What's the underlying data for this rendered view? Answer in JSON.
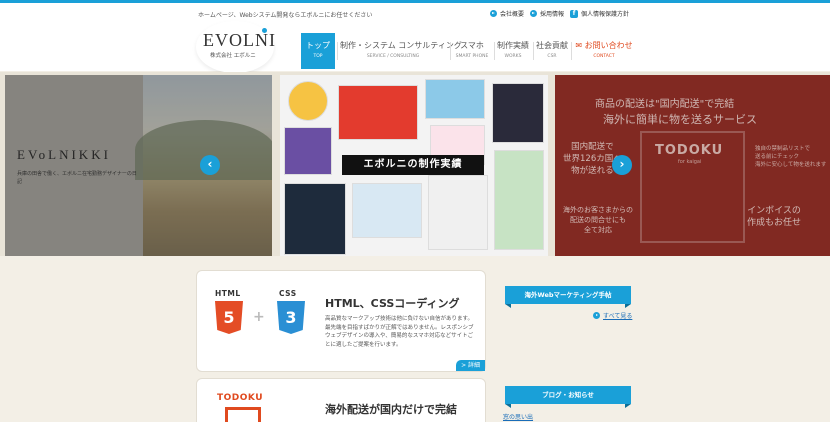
{
  "header": {
    "tagline": "ホームページ、Webシステム開発ならエボルニにお任せください",
    "util_links": [
      {
        "label": "会社概要",
        "icon": "arrow-circle-icon"
      },
      {
        "label": "採用情報",
        "icon": "arrow-circle-icon"
      },
      {
        "label": "個人情報保護方針",
        "icon": "facebook-icon"
      }
    ],
    "logo": "EVOLNI",
    "logo_sub": "株式会社 エボルニ",
    "nav": [
      {
        "ja": "トップ",
        "en": "TOP",
        "active": true
      },
      {
        "ja": "制作・システム コンサルティング",
        "en": "SERVICE / CONSULTING"
      },
      {
        "ja": "スマホ",
        "en": "SMART PHONE"
      },
      {
        "ja": "制作実績",
        "en": "WORKS"
      },
      {
        "ja": "社会貢献",
        "en": "CSR"
      },
      {
        "ja": "お問い合わせ",
        "en": "CONTACT",
        "icon": "mail-icon"
      }
    ]
  },
  "slider": {
    "left": {
      "title": "EVoLNIKKI",
      "sub": "兵庫の田舎で働く、エボルニ在宅勤務デザイナーの日記"
    },
    "center": {
      "label": "エボルニの制作実績"
    },
    "right": {
      "head1": "商品の配送は\"国内配送\"で完結",
      "head2": "海外に簡単に物を送るサービス",
      "left_text": [
        "国内配送で",
        "世界126カ国へ",
        "物が送れる"
      ],
      "left_text2": [
        "海外のお客さまからの",
        "配送の問合せにも",
        "全て対応"
      ],
      "logo": "TODOKU",
      "logo_sub": "for kaigai",
      "right_small": [
        "独自の禁制品リストで",
        "送る前にチェック",
        "海外に安心して物を送れます"
      ],
      "right_big": [
        "インボイスの",
        "作成もお任せ"
      ]
    },
    "prev_icon": "chevron-left-icon",
    "next_icon": "chevron-right-icon"
  },
  "cards": [
    {
      "title": "HTML、CSSコーディング",
      "text": "高品質なマークアップ技術は他に負けない自信があります。最先端を目指すばかりが正解ではありません。レスポンシブウェブデザインの導入や、簡易的なスマホ対応などサイトごとに適したご提案を行います。",
      "badge1": "HTML",
      "badge1_num": "5",
      "badge2": "CSS",
      "badge2_num": "3",
      "detail": "> 詳細",
      "colors": {
        "html": "#e44d26",
        "css": "#2a8fd4"
      }
    },
    {
      "title": "海外配送が国内だけで完結",
      "logo": "TODOKU"
    }
  ],
  "sidebar": {
    "banner1": "海外Webマーケティング手帖",
    "see_all": "すべて見る",
    "banner2": "ブログ・お知らせ",
    "blog_first": "窓の思い出"
  }
}
